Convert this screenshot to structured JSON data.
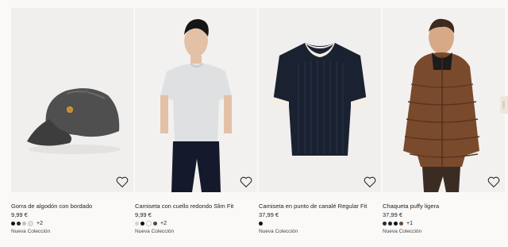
{
  "products": [
    {
      "title": "Gorra de algodón con bordado",
      "price": "9,99 €",
      "swatches": [
        "#111111",
        "#2b2b2b",
        "#c9bfa9",
        "#e7e2d6"
      ],
      "more": "+2",
      "tag": "Nueva Colección",
      "image_icon": "cap-image"
    },
    {
      "title": "Camiseta con cuello redondo Slim Fit",
      "price": "9,99 €",
      "swatches": [
        "#cfd2d6",
        "#111111",
        "#ffffff",
        "#4b4b4b"
      ],
      "more": "+2",
      "tag": "Nueva Colección",
      "image_icon": "tshirt-model-image"
    },
    {
      "title": "Camiseta en punto de canalé Regular Fit",
      "price": "37,99 €",
      "swatches": [
        "#111111"
      ],
      "more": "",
      "tag": "Nueva Colección",
      "image_icon": "knit-tshirt-image"
    },
    {
      "title": "Chaqueta puffy ligera",
      "price": "37,99 €",
      "swatches": [
        "#2a2a2a",
        "#1c2435",
        "#111111",
        "#6d4a32"
      ],
      "more": "+1",
      "tag": "Nueva Colección",
      "image_icon": "puffer-jacket-model-image"
    }
  ],
  "colors": {
    "background": "#faf9f8",
    "card_bg": "#f0efed",
    "text": "#222222"
  }
}
